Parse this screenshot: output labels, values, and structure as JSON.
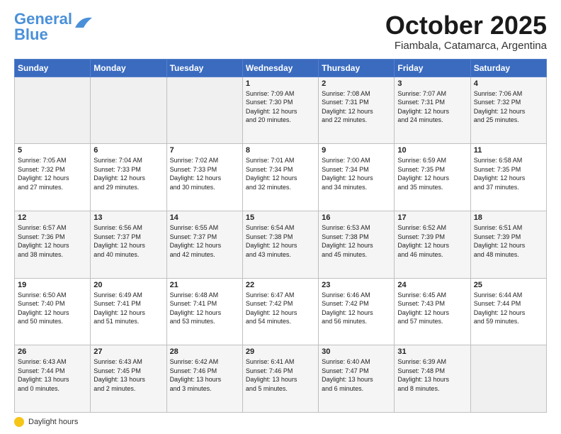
{
  "header": {
    "logo_general": "General",
    "logo_blue": "Blue",
    "month_title": "October 2025",
    "subtitle": "Fiambala, Catamarca, Argentina"
  },
  "footer": {
    "daylight_label": "Daylight hours"
  },
  "days_of_week": [
    "Sunday",
    "Monday",
    "Tuesday",
    "Wednesday",
    "Thursday",
    "Friday",
    "Saturday"
  ],
  "weeks": [
    [
      {
        "num": "",
        "info": ""
      },
      {
        "num": "",
        "info": ""
      },
      {
        "num": "",
        "info": ""
      },
      {
        "num": "1",
        "info": "Sunrise: 7:09 AM\nSunset: 7:30 PM\nDaylight: 12 hours\nand 20 minutes."
      },
      {
        "num": "2",
        "info": "Sunrise: 7:08 AM\nSunset: 7:31 PM\nDaylight: 12 hours\nand 22 minutes."
      },
      {
        "num": "3",
        "info": "Sunrise: 7:07 AM\nSunset: 7:31 PM\nDaylight: 12 hours\nand 24 minutes."
      },
      {
        "num": "4",
        "info": "Sunrise: 7:06 AM\nSunset: 7:32 PM\nDaylight: 12 hours\nand 25 minutes."
      }
    ],
    [
      {
        "num": "5",
        "info": "Sunrise: 7:05 AM\nSunset: 7:32 PM\nDaylight: 12 hours\nand 27 minutes."
      },
      {
        "num": "6",
        "info": "Sunrise: 7:04 AM\nSunset: 7:33 PM\nDaylight: 12 hours\nand 29 minutes."
      },
      {
        "num": "7",
        "info": "Sunrise: 7:02 AM\nSunset: 7:33 PM\nDaylight: 12 hours\nand 30 minutes."
      },
      {
        "num": "8",
        "info": "Sunrise: 7:01 AM\nSunset: 7:34 PM\nDaylight: 12 hours\nand 32 minutes."
      },
      {
        "num": "9",
        "info": "Sunrise: 7:00 AM\nSunset: 7:34 PM\nDaylight: 12 hours\nand 34 minutes."
      },
      {
        "num": "10",
        "info": "Sunrise: 6:59 AM\nSunset: 7:35 PM\nDaylight: 12 hours\nand 35 minutes."
      },
      {
        "num": "11",
        "info": "Sunrise: 6:58 AM\nSunset: 7:35 PM\nDaylight: 12 hours\nand 37 minutes."
      }
    ],
    [
      {
        "num": "12",
        "info": "Sunrise: 6:57 AM\nSunset: 7:36 PM\nDaylight: 12 hours\nand 38 minutes."
      },
      {
        "num": "13",
        "info": "Sunrise: 6:56 AM\nSunset: 7:37 PM\nDaylight: 12 hours\nand 40 minutes."
      },
      {
        "num": "14",
        "info": "Sunrise: 6:55 AM\nSunset: 7:37 PM\nDaylight: 12 hours\nand 42 minutes."
      },
      {
        "num": "15",
        "info": "Sunrise: 6:54 AM\nSunset: 7:38 PM\nDaylight: 12 hours\nand 43 minutes."
      },
      {
        "num": "16",
        "info": "Sunrise: 6:53 AM\nSunset: 7:38 PM\nDaylight: 12 hours\nand 45 minutes."
      },
      {
        "num": "17",
        "info": "Sunrise: 6:52 AM\nSunset: 7:39 PM\nDaylight: 12 hours\nand 46 minutes."
      },
      {
        "num": "18",
        "info": "Sunrise: 6:51 AM\nSunset: 7:39 PM\nDaylight: 12 hours\nand 48 minutes."
      }
    ],
    [
      {
        "num": "19",
        "info": "Sunrise: 6:50 AM\nSunset: 7:40 PM\nDaylight: 12 hours\nand 50 minutes."
      },
      {
        "num": "20",
        "info": "Sunrise: 6:49 AM\nSunset: 7:41 PM\nDaylight: 12 hours\nand 51 minutes."
      },
      {
        "num": "21",
        "info": "Sunrise: 6:48 AM\nSunset: 7:41 PM\nDaylight: 12 hours\nand 53 minutes."
      },
      {
        "num": "22",
        "info": "Sunrise: 6:47 AM\nSunset: 7:42 PM\nDaylight: 12 hours\nand 54 minutes."
      },
      {
        "num": "23",
        "info": "Sunrise: 6:46 AM\nSunset: 7:42 PM\nDaylight: 12 hours\nand 56 minutes."
      },
      {
        "num": "24",
        "info": "Sunrise: 6:45 AM\nSunset: 7:43 PM\nDaylight: 12 hours\nand 57 minutes."
      },
      {
        "num": "25",
        "info": "Sunrise: 6:44 AM\nSunset: 7:44 PM\nDaylight: 12 hours\nand 59 minutes."
      }
    ],
    [
      {
        "num": "26",
        "info": "Sunrise: 6:43 AM\nSunset: 7:44 PM\nDaylight: 13 hours\nand 0 minutes."
      },
      {
        "num": "27",
        "info": "Sunrise: 6:43 AM\nSunset: 7:45 PM\nDaylight: 13 hours\nand 2 minutes."
      },
      {
        "num": "28",
        "info": "Sunrise: 6:42 AM\nSunset: 7:46 PM\nDaylight: 13 hours\nand 3 minutes."
      },
      {
        "num": "29",
        "info": "Sunrise: 6:41 AM\nSunset: 7:46 PM\nDaylight: 13 hours\nand 5 minutes."
      },
      {
        "num": "30",
        "info": "Sunrise: 6:40 AM\nSunset: 7:47 PM\nDaylight: 13 hours\nand 6 minutes."
      },
      {
        "num": "31",
        "info": "Sunrise: 6:39 AM\nSunset: 7:48 PM\nDaylight: 13 hours\nand 8 minutes."
      },
      {
        "num": "",
        "info": ""
      }
    ]
  ]
}
